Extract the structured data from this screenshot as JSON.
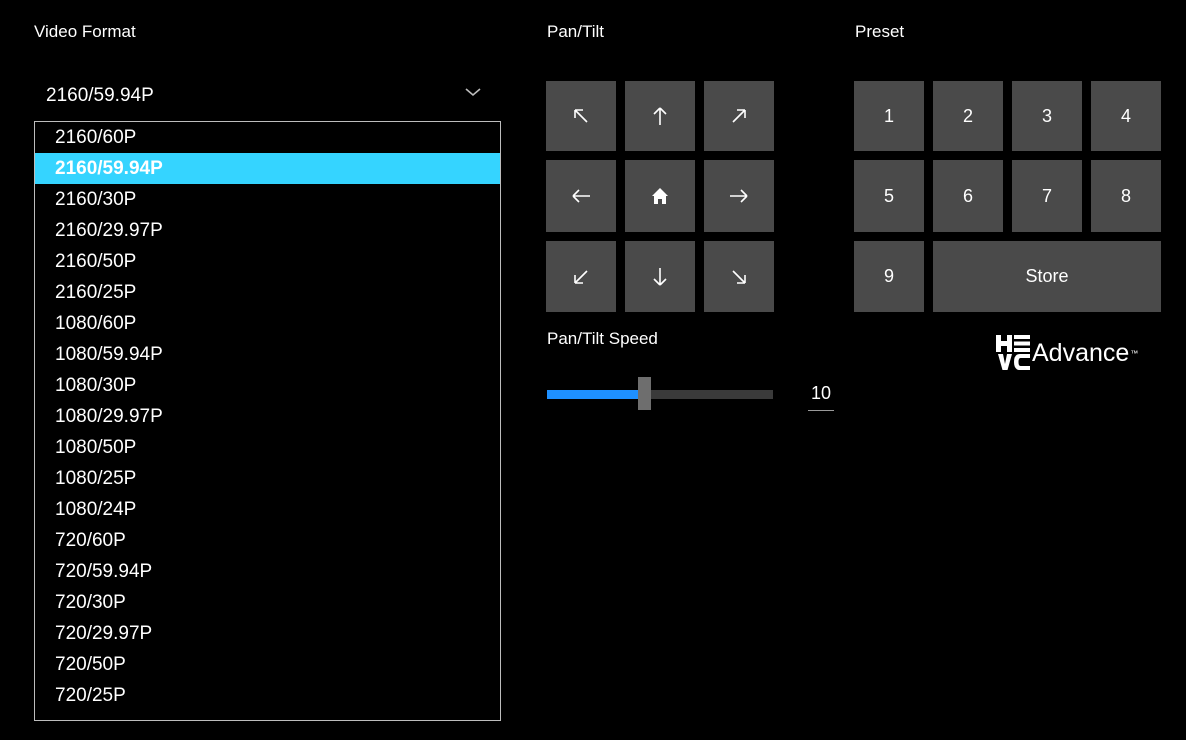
{
  "colors": {
    "background": "#000000",
    "button": "#4a4a4a",
    "selected_option": "#35d4ff",
    "slider_fill": "#1e90ff"
  },
  "video_format": {
    "label": "Video Format",
    "selected": "2160/59.94P",
    "options": [
      "2160/60P",
      "2160/59.94P",
      "2160/30P",
      "2160/29.97P",
      "2160/50P",
      "2160/25P",
      "1080/60P",
      "1080/59.94P",
      "1080/30P",
      "1080/29.97P",
      "1080/50P",
      "1080/25P",
      "1080/24P",
      "720/60P",
      "720/59.94P",
      "720/30P",
      "720/29.97P",
      "720/50P",
      "720/25P"
    ]
  },
  "pan_tilt": {
    "label": "Pan/Tilt",
    "buttons": [
      "arrow-up-left-icon",
      "arrow-up-icon",
      "arrow-up-right-icon",
      "arrow-left-icon",
      "home-icon",
      "arrow-right-icon",
      "arrow-down-left-icon",
      "arrow-down-icon",
      "arrow-down-right-icon"
    ]
  },
  "speed": {
    "label": "Pan/Tilt Speed",
    "value": "10",
    "fill_fraction": 0.43
  },
  "preset": {
    "label": "Preset",
    "buttons": [
      "1",
      "2",
      "3",
      "4",
      "5",
      "6",
      "7",
      "8",
      "9"
    ],
    "store_label": "Store"
  },
  "logo": {
    "mark": "HE VC",
    "text": "Advance",
    "tm": "™"
  }
}
